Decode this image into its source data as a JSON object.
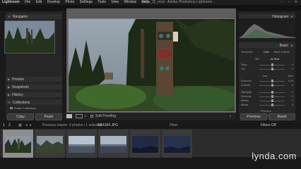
{
  "titlebar": {
    "menus": [
      "Lightroom",
      "File",
      "Edit",
      "Develop",
      "Photo",
      "Settings",
      "Tools",
      "View",
      "Window",
      "Help"
    ],
    "window_title": "lynda_15_mod - Adobe Photoshop Lightroom - Develop",
    "controls": "– ▫ ✕"
  },
  "left_panel": {
    "navigator_label": "Navigator",
    "presets_label": "Presets",
    "snapshots_label": "Snapshots",
    "history_label": "History",
    "collections_label": "Collections",
    "smart_collections_label": "Smart Collections",
    "copy_label": "Copy",
    "paste_label": "Paste"
  },
  "right_panel": {
    "histogram_label": "Histogram",
    "basic_label": "Basic",
    "treatment_label": "Treatment:",
    "color_label": "Color",
    "bw_label": "Black & White",
    "wb_label": "WB:",
    "wb_value": "As Shot",
    "sliders": [
      {
        "label": "Temp",
        "value": "0"
      },
      {
        "label": "Tint",
        "value": "0"
      },
      {
        "label": "Tone",
        "value": "Auto"
      },
      {
        "label": "Exposure",
        "value": "0.00"
      },
      {
        "label": "Contrast",
        "value": "0"
      },
      {
        "label": "Highlights",
        "value": "0"
      },
      {
        "label": "Shadows",
        "value": "0"
      },
      {
        "label": "Whites",
        "value": "0"
      },
      {
        "label": "Blacks",
        "value": "0"
      },
      {
        "label": "Presence",
        "value": ""
      },
      {
        "label": "Clarity",
        "value": "0"
      }
    ],
    "previous_label": "Previous",
    "reset_label": "Reset"
  },
  "toolbar": {
    "soft_proofing_label": "Soft Proofing"
  },
  "filmbar": {
    "page1": "1",
    "page2": "2",
    "previous_import": "Previous Import",
    "count": "6 photos / 1 selected",
    "filename": "/084184.JPG",
    "filter_label": "Filter:",
    "filter_value": "Filters Off"
  },
  "watermark": "lynda.com"
}
